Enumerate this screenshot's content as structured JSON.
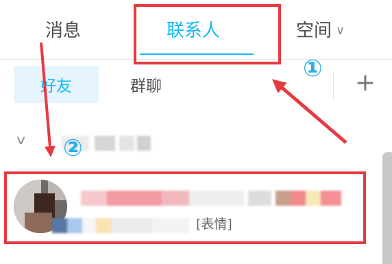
{
  "tabs": {
    "messages": "消息",
    "contacts": "联系人",
    "space": "空间",
    "space_chevron": "∨",
    "active": "contacts"
  },
  "subtabs": {
    "friends": "好友",
    "groups": "群聊",
    "add": "+"
  },
  "group": {
    "chevron": "∨"
  },
  "contact": {
    "preview_suffix": "[表情]"
  },
  "annotations": {
    "marker_1": "①",
    "marker_2": "②"
  },
  "colors": {
    "accent": "#12b7f5",
    "highlight_box": "#e53a40",
    "marker": "#29aee8"
  }
}
